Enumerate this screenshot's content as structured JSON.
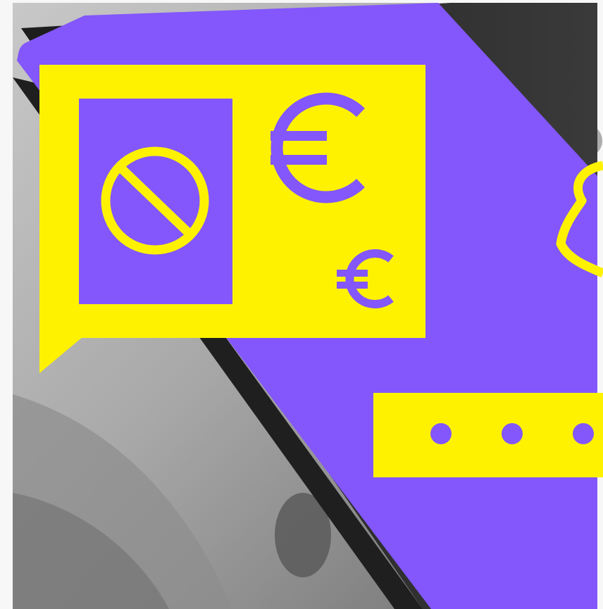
{
  "illustration": {
    "alt": "",
    "colors": {
      "page_background": "#f7f7f7",
      "photo_light": "#d9d9d9",
      "photo_dark": "#8a8a8a",
      "phone_body": "#2a2a2a",
      "screen_purple": "#8357fb",
      "accent_yellow": "#fff200"
    },
    "symbols": {
      "prohibited": "prohibited-icon",
      "currency_large": "€",
      "currency_small": "€",
      "password_dots": "password-dots-icon",
      "notification": "bell-icon"
    }
  }
}
